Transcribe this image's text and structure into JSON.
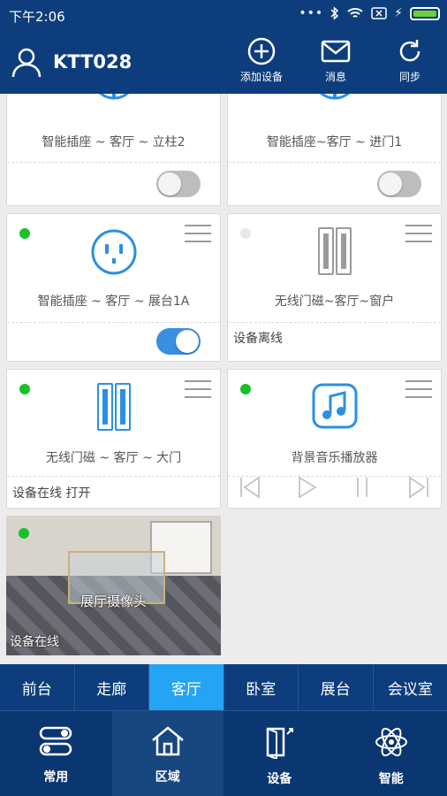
{
  "status_bar": {
    "time": "下午2:06"
  },
  "header": {
    "username": "KTT028",
    "add_device_label": "添加设备",
    "messages_label": "消息",
    "sync_label": "同步"
  },
  "devices": [
    {
      "name": "智能插座 ~ 客厅 ~ 立柱2",
      "switch": "off"
    },
    {
      "name": "智能插座~客厅 ~ 进门1",
      "switch": "off"
    },
    {
      "name": "智能插座 ~ 客厅 ~ 展台1A",
      "switch": "on"
    },
    {
      "name": "无线门磁~客厅~窗户",
      "status": "设备离线"
    },
    {
      "name": "无线门磁 ~ 客厅 ~ 大门",
      "status": "设备在线 打开"
    },
    {
      "name": "背景音乐播放器"
    }
  ],
  "camera": {
    "name": "展厅摄像头",
    "status": "设备在线"
  },
  "room_tabs": [
    "前台",
    "走廊",
    "客厅",
    "卧室",
    "展台",
    "会议室"
  ],
  "active_room": "客厅",
  "bottom_nav": [
    {
      "label": "常用",
      "icon": "toggle-icon"
    },
    {
      "label": "区域",
      "icon": "home-icon"
    },
    {
      "label": "设备",
      "icon": "door-icon"
    },
    {
      "label": "智能",
      "icon": "atom-icon"
    }
  ],
  "colors": {
    "primary": "#0d3d7c",
    "active_tab": "#24a4f3",
    "online": "#19c02a",
    "icon_blue": "#2b8fe3"
  }
}
